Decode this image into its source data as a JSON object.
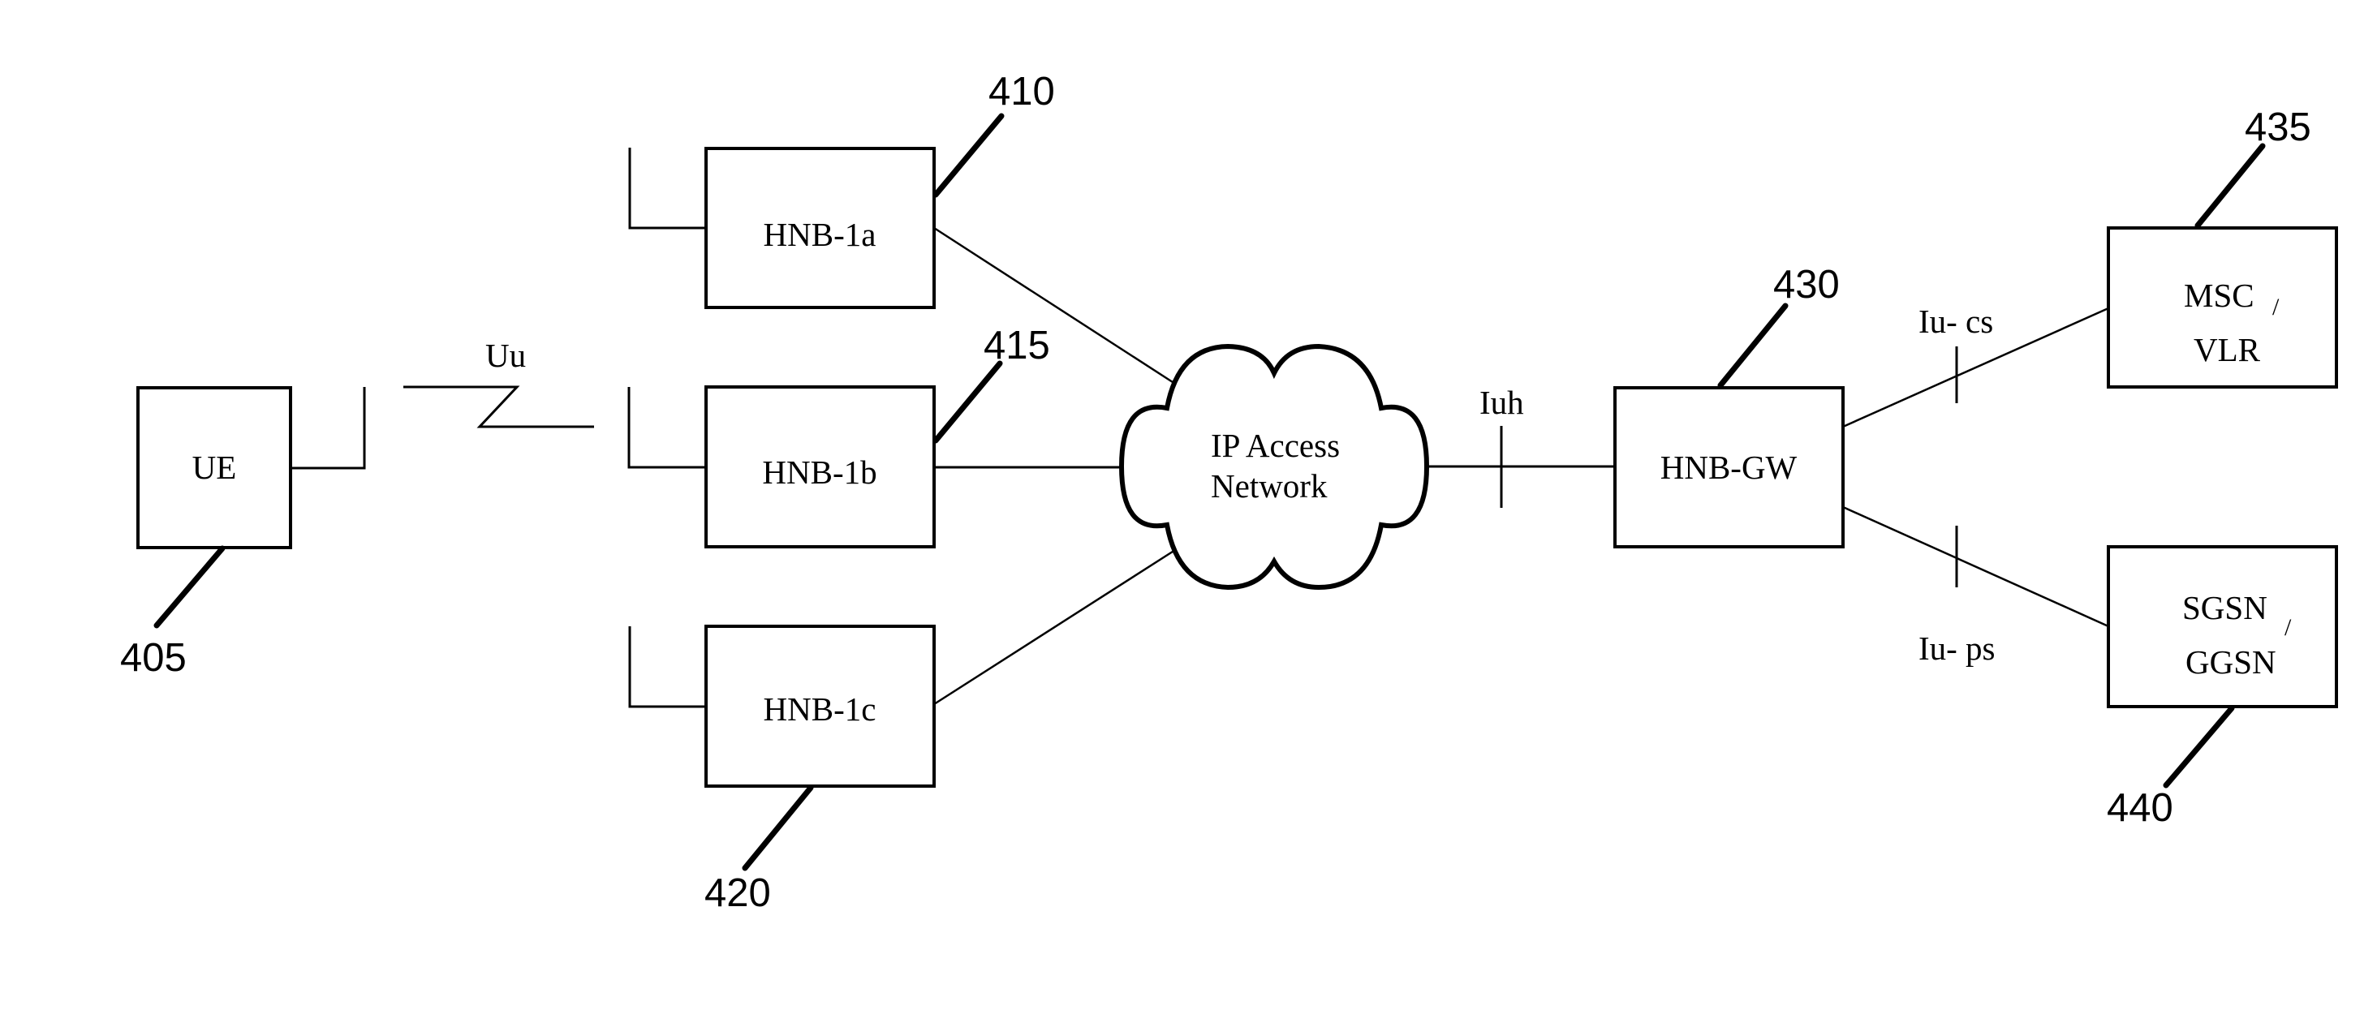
{
  "figure": {
    "nodes": {
      "ue": {
        "label": "UE",
        "ref": "405"
      },
      "hnb_1a": {
        "label": "HNB-1a",
        "ref": "410"
      },
      "hnb_1b": {
        "label": "HNB-1b",
        "ref": "415"
      },
      "hnb_1c": {
        "label": "HNB-1c",
        "ref": "420"
      },
      "ip_access_network": {
        "label_line1": "IP Access",
        "label_line2": "Network"
      },
      "hnb_gw": {
        "label": "HNB-GW",
        "ref": "430"
      },
      "msc_vlr": {
        "label_line1": "MSC",
        "slash": "/",
        "label_line2": "VLR",
        "ref": "435"
      },
      "sgsn_ggsn": {
        "label_line1": "SGSN",
        "slash": "/",
        "label_line2": "GGSN",
        "ref": "440"
      }
    },
    "interfaces": {
      "uu": "Uu",
      "iuh": "Iuh",
      "iu_cs": "Iu- cs",
      "iu_ps": "Iu- ps"
    }
  }
}
